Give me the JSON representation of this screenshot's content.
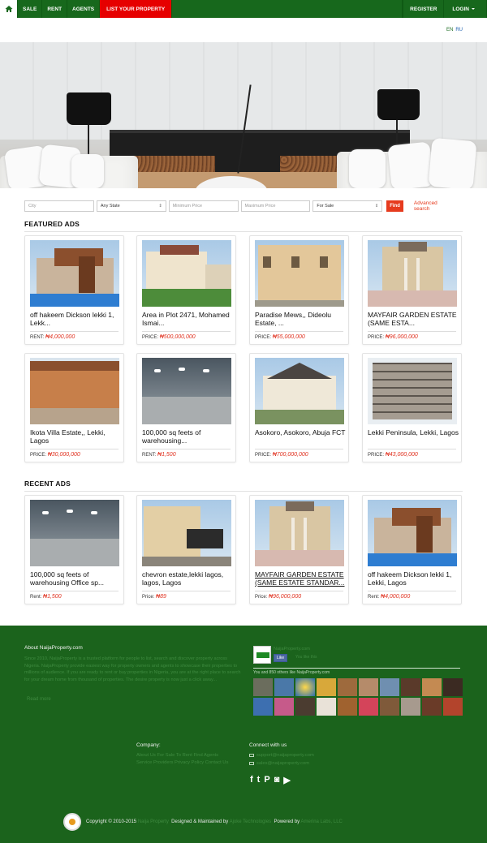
{
  "nav": {
    "home_icon": "home-icon",
    "sale": "SALE",
    "rent": "RENT",
    "agents": "AGENTS",
    "list_property": "LIST YOUR PROPERTY",
    "register": "REGISTER",
    "login": "LOGIN"
  },
  "lang": {
    "en": "EN",
    "ru": "RU"
  },
  "search": {
    "city_placeholder": "City",
    "state_value": "Any State",
    "min_placeholder": "Minimum Price",
    "max_placeholder": "Maximum Price",
    "type_value": "For Sale",
    "find": "Find",
    "advanced": "Advanced search"
  },
  "featured": {
    "title": "FEATURED ADS",
    "items": [
      {
        "title": "off hakeem Dickson lekki 1, Lekk...",
        "price_label": "RENT:",
        "price": "₦4,000,000"
      },
      {
        "title": "Area in Plot 2471, Mohamed Ismai...",
        "price_label": "PRICE:",
        "price": "₦500,000,000"
      },
      {
        "title": "Paradise Mews,, Dideolu Estate, ...",
        "price_label": "PRICE:",
        "price": "₦55,000,000"
      },
      {
        "title": "MAYFAIR GARDEN ESTATE (SAME ESTA...",
        "price_label": "PRICE:",
        "price": "₦96,000,000"
      },
      {
        "title": "Ikota Villa Estate,, Lekki, Lagos",
        "price_label": "PRICE:",
        "price": "₦30,000,000"
      },
      {
        "title": "100,000 sq feets of warehousing...",
        "price_label": "RENT:",
        "price": "₦1,500"
      },
      {
        "title": "Asokoro, Asokoro, Abuja FCT",
        "price_label": "PRICE:",
        "price": "₦700,000,000"
      },
      {
        "title": "Lekki Peninsula, Lekki, Lagos",
        "price_label": "PRICE:",
        "price": "₦43,000,000"
      }
    ]
  },
  "recent": {
    "title": "RECENT ADS",
    "items": [
      {
        "title": "100,000 sq feets of warehousing Office sp...",
        "price_label": "Rent:",
        "price": "₦1,500"
      },
      {
        "title": "chevron estate,lekki lagos, lagos, Lagos",
        "price_label": "Price:",
        "price": "₦89"
      },
      {
        "title": "MAYFAIR GARDEN ESTATE (SAME ESTATE STANDAR...",
        "price_label": "Price:",
        "price": "₦96,000,000"
      },
      {
        "title": "off hakeem Dickson lekki 1, Lekki, Lagos",
        "price_label": "Rent:",
        "price": "₦4,000,000"
      }
    ]
  },
  "footer": {
    "about_heading": "About NaijaProperty.com",
    "about_text": "Since 2010, NaijaProperty is a trusted platform for people to list, search and discover property across Nigeria. NaijaProperty provide easiest way for property owners and agents to showcase their properties to millions of audience. If you are ready to rent or buy properties in Nigeria, you are at the right place to search for your dream home from thousand of properties. The desire property is now just a click away...",
    "read_more": "Read more",
    "fb_name": "NaijaProperty.com",
    "fb_like": "Like",
    "fb_like_count": "You like this",
    "fb_count": "You and 850 others like NaijaProperty.com",
    "company_heading": "Company:",
    "company_links": "About Us  For Sale  To Rent  Find Agents  Service Providers  Privacy Policy  Contact Us",
    "connect_heading": "Connect with us",
    "email_support": "support@naijaproperty.com",
    "email_sales": "sales@naijaproperty.com",
    "copyright": "Copyright © 2010-2015",
    "copyright_link": "Naija Property",
    "designed": "Designed & Maintained by",
    "designed_link": "Ajoke Technologies",
    "powered": "Powered by",
    "powered_link": "Amerina Labs, LLC"
  }
}
